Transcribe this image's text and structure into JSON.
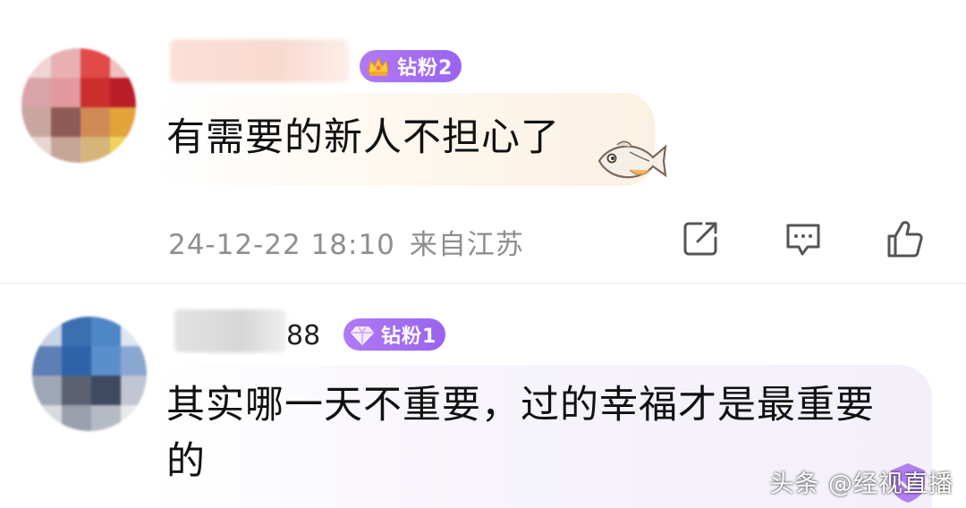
{
  "comments": [
    {
      "badge_label": "钻粉2",
      "badge_icon": "crown-icon",
      "name_tail": "",
      "content": "有需要的新人不担心了",
      "emoji": "fish-emoji",
      "timestamp": "24-12-22 18:10",
      "location": "来自江苏",
      "actions": [
        "share-icon",
        "comment-icon",
        "like-icon"
      ]
    },
    {
      "badge_label": "钻粉1",
      "badge_icon": "diamond-icon",
      "name_tail": "88",
      "content_line1": "其实哪一天不重要，过的幸福才是最重要",
      "content_line2": "的"
    }
  ],
  "watermark": "头条 @经视直播",
  "colors": {
    "badge": "#a36cf2",
    "meta_text": "#8e8e8e",
    "bubble": "#fdf7ef",
    "bubble2": "#f6f3fb"
  }
}
